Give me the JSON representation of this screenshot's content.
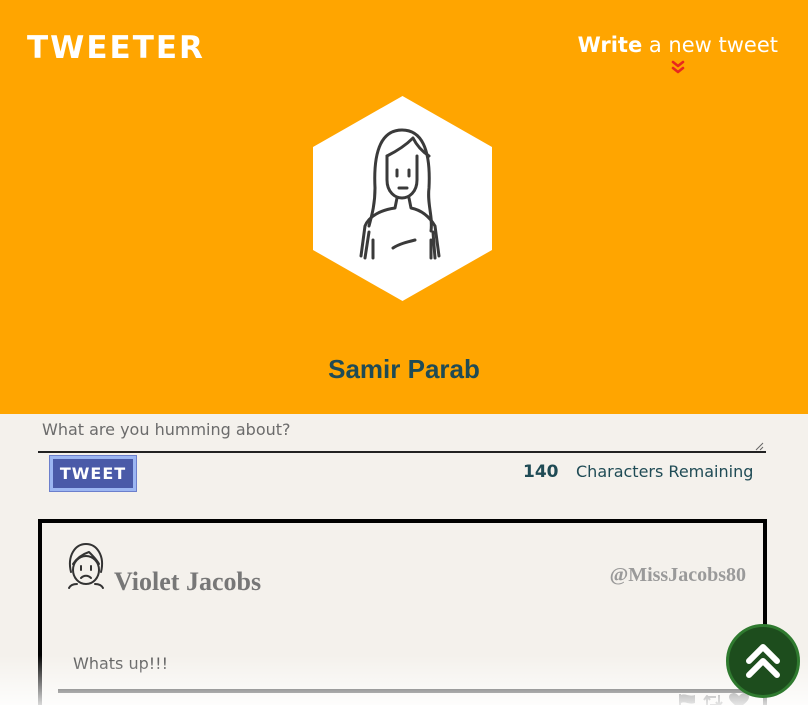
{
  "app": {
    "logo": "TWEETER"
  },
  "header": {
    "compose_bold": "Write",
    "compose_rest": " a new tweet",
    "chevron_icon": "double-chevron-down-icon",
    "chevron_color": "#e8281e",
    "background_color": "#ffa500"
  },
  "profile": {
    "name": "Samir Parab",
    "avatar_icon": "woman-avatar-icon"
  },
  "composer": {
    "placeholder": "What are you humming about?",
    "button_label": "TWEET",
    "char_count": "140",
    "char_label": "Characters Remaining"
  },
  "tweets": [
    {
      "name": "Violet Jacobs",
      "handle": "@MissJacobs80",
      "text": "Whats up!!!",
      "avatar_icon": "sad-face-avatar-icon",
      "actions": [
        "flag-icon",
        "retweet-icon",
        "heart-icon"
      ]
    }
  ],
  "scroll_top": {
    "icon": "double-chevron-up-icon",
    "color": "#1d4d1d"
  }
}
